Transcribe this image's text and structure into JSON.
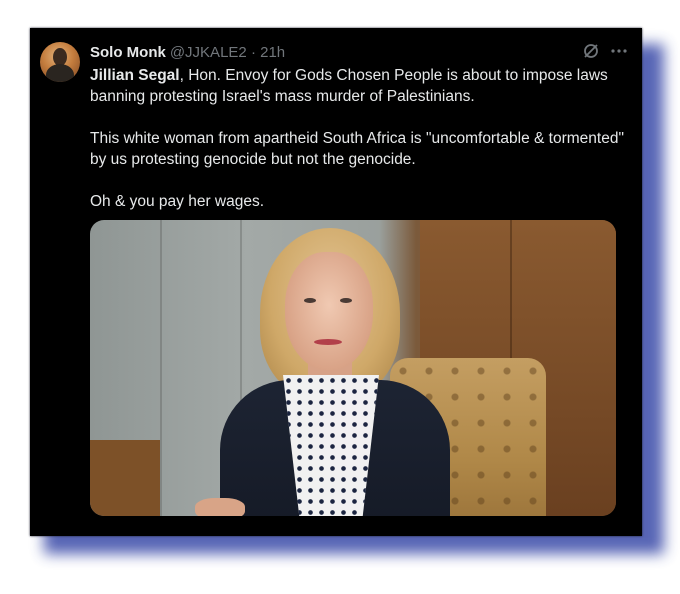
{
  "tweet": {
    "author": {
      "name": "Solo Monk",
      "handle": "@JJKALE2",
      "separator": "·",
      "time": "21h",
      "avatar_icon": "avatar"
    },
    "menu_icons": [
      "grok-icon",
      "more-icon"
    ],
    "mention": "Jillian Segal",
    "paragraph1_rest": ", Hon. Envoy for Gods Chosen People is about to impose laws banning protesting Israel's mass murder of Palestinians.",
    "paragraph2": "This white woman from apartheid South Africa is  \"uncomfortable & tormented\" by us protesting genocide but not the genocide.",
    "paragraph3": "Oh & you pay her wages.",
    "image_description_icon": "photo"
  },
  "colors": {
    "card_background": "#000000",
    "text": "#e7e9ea",
    "muted": "#71767b",
    "shadow": "#3a4aa8"
  }
}
